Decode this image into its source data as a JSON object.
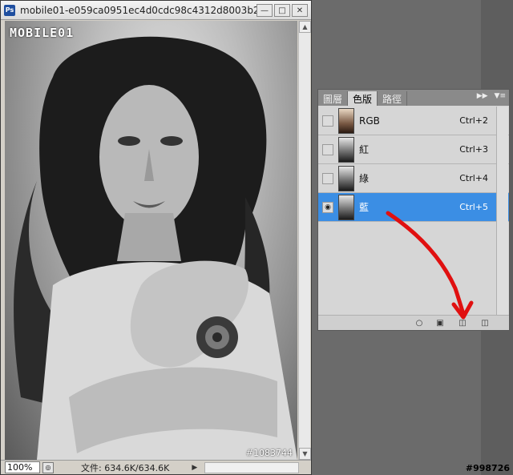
{
  "document": {
    "title": "mobile01-e059ca0951ec4d0cdc98c4312d8003b2.jpg ...",
    "logo_text": "MOBILE01",
    "image_watermark": "#1083744",
    "zoom": "100%",
    "doc_size": "文件: 634.6K/634.6K"
  },
  "channels_panel": {
    "tabs": [
      {
        "label": "圖層"
      },
      {
        "label": "色版"
      },
      {
        "label": "路徑"
      }
    ],
    "channels": [
      {
        "name": "RGB",
        "shortcut": "Ctrl+2"
      },
      {
        "name": "紅",
        "shortcut": "Ctrl+3"
      },
      {
        "name": "綠",
        "shortcut": "Ctrl+4"
      },
      {
        "name": "藍",
        "shortcut": "Ctrl+5"
      }
    ]
  },
  "corner_watermark": "#998726",
  "annotation_color": "#e01010",
  "selection_color": "#3b8ee4"
}
